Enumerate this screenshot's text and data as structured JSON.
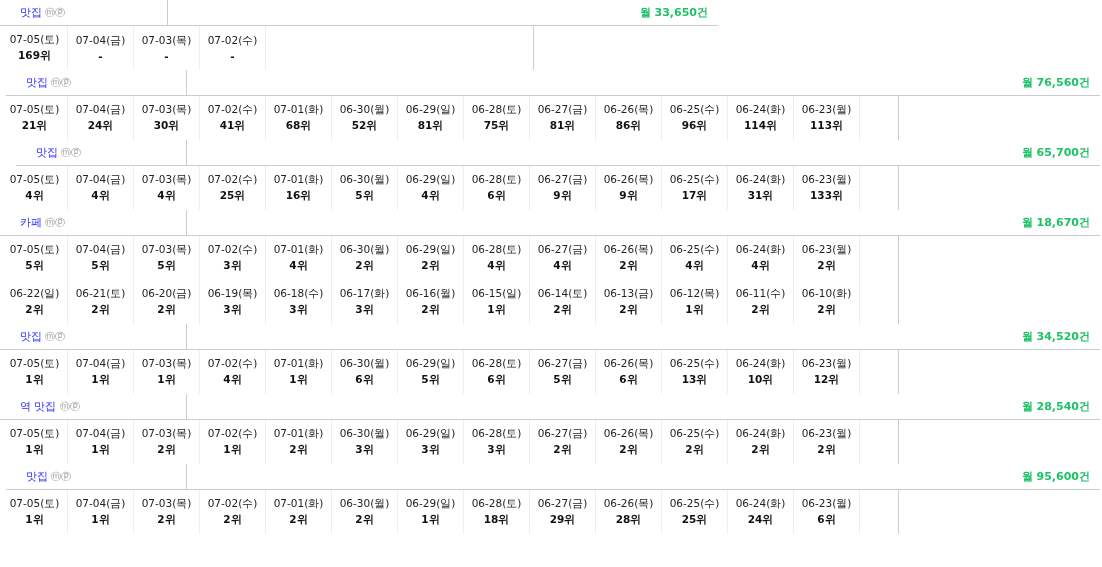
{
  "blocks": [
    {
      "label": "맛집",
      "badges": "ⓜⓟ",
      "count": "월 33,650건",
      "rows": [
        [
          {
            "date": "07-05(토)",
            "rank": "169위"
          },
          {
            "date": "07-04(금)",
            "rank": "-"
          },
          {
            "date": "07-03(목)",
            "rank": "-"
          },
          {
            "date": "07-02(수)",
            "rank": "-"
          }
        ]
      ]
    },
    {
      "label": "맛집",
      "badges": "ⓜⓟ",
      "count": "월 76,560건",
      "rows": [
        [
          {
            "date": "07-05(토)",
            "rank": "21위"
          },
          {
            "date": "07-04(금)",
            "rank": "24위"
          },
          {
            "date": "07-03(목)",
            "rank": "30위"
          },
          {
            "date": "07-02(수)",
            "rank": "41위"
          },
          {
            "date": "07-01(화)",
            "rank": "68위"
          },
          {
            "date": "06-30(월)",
            "rank": "52위"
          },
          {
            "date": "06-29(일)",
            "rank": "81위"
          },
          {
            "date": "06-28(토)",
            "rank": "75위"
          },
          {
            "date": "06-27(금)",
            "rank": "81위"
          },
          {
            "date": "06-26(목)",
            "rank": "86위"
          },
          {
            "date": "06-25(수)",
            "rank": "96위"
          },
          {
            "date": "06-24(화)",
            "rank": "114위"
          },
          {
            "date": "06-23(월)",
            "rank": "113위"
          }
        ]
      ]
    },
    {
      "label": "맛집",
      "badges": "ⓜⓟ",
      "count": "월 65,700건",
      "rows": [
        [
          {
            "date": "07-05(토)",
            "rank": "4위"
          },
          {
            "date": "07-04(금)",
            "rank": "4위"
          },
          {
            "date": "07-03(목)",
            "rank": "4위"
          },
          {
            "date": "07-02(수)",
            "rank": "25위"
          },
          {
            "date": "07-01(화)",
            "rank": "16위"
          },
          {
            "date": "06-30(월)",
            "rank": "5위"
          },
          {
            "date": "06-29(일)",
            "rank": "4위"
          },
          {
            "date": "06-28(토)",
            "rank": "6위"
          },
          {
            "date": "06-27(금)",
            "rank": "9위"
          },
          {
            "date": "06-26(목)",
            "rank": "9위"
          },
          {
            "date": "06-25(수)",
            "rank": "17위"
          },
          {
            "date": "06-24(화)",
            "rank": "31위"
          },
          {
            "date": "06-23(월)",
            "rank": "133위"
          }
        ]
      ]
    },
    {
      "label": "카페",
      "badges": "ⓜⓟ",
      "count": "월 18,670건",
      "rows": [
        [
          {
            "date": "07-05(토)",
            "rank": "5위"
          },
          {
            "date": "07-04(금)",
            "rank": "5위"
          },
          {
            "date": "07-03(목)",
            "rank": "5위"
          },
          {
            "date": "07-02(수)",
            "rank": "3위"
          },
          {
            "date": "07-01(화)",
            "rank": "4위"
          },
          {
            "date": "06-30(월)",
            "rank": "2위"
          },
          {
            "date": "06-29(일)",
            "rank": "2위"
          },
          {
            "date": "06-28(토)",
            "rank": "4위"
          },
          {
            "date": "06-27(금)",
            "rank": "4위"
          },
          {
            "date": "06-26(목)",
            "rank": "2위"
          },
          {
            "date": "06-25(수)",
            "rank": "4위"
          },
          {
            "date": "06-24(화)",
            "rank": "4위"
          },
          {
            "date": "06-23(월)",
            "rank": "2위"
          }
        ],
        [
          {
            "date": "06-22(일)",
            "rank": "2위"
          },
          {
            "date": "06-21(토)",
            "rank": "2위"
          },
          {
            "date": "06-20(금)",
            "rank": "2위"
          },
          {
            "date": "06-19(목)",
            "rank": "3위"
          },
          {
            "date": "06-18(수)",
            "rank": "3위"
          },
          {
            "date": "06-17(화)",
            "rank": "3위"
          },
          {
            "date": "06-16(월)",
            "rank": "2위"
          },
          {
            "date": "06-15(일)",
            "rank": "1위"
          },
          {
            "date": "06-14(토)",
            "rank": "2위"
          },
          {
            "date": "06-13(금)",
            "rank": "2위"
          },
          {
            "date": "06-12(목)",
            "rank": "1위"
          },
          {
            "date": "06-11(수)",
            "rank": "2위"
          },
          {
            "date": "06-10(화)",
            "rank": "2위"
          }
        ]
      ]
    },
    {
      "label": "맛집",
      "badges": "ⓜⓟ",
      "count": "월 34,520건",
      "rows": [
        [
          {
            "date": "07-05(토)",
            "rank": "1위"
          },
          {
            "date": "07-04(금)",
            "rank": "1위"
          },
          {
            "date": "07-03(목)",
            "rank": "1위"
          },
          {
            "date": "07-02(수)",
            "rank": "4위"
          },
          {
            "date": "07-01(화)",
            "rank": "1위"
          },
          {
            "date": "06-30(월)",
            "rank": "6위"
          },
          {
            "date": "06-29(일)",
            "rank": "5위"
          },
          {
            "date": "06-28(토)",
            "rank": "6위"
          },
          {
            "date": "06-27(금)",
            "rank": "5위"
          },
          {
            "date": "06-26(목)",
            "rank": "6위"
          },
          {
            "date": "06-25(수)",
            "rank": "13위"
          },
          {
            "date": "06-24(화)",
            "rank": "10위"
          },
          {
            "date": "06-23(월)",
            "rank": "12위"
          }
        ]
      ]
    },
    {
      "label": "역 맛집",
      "badges": "ⓜⓟ",
      "count": "월 28,540건",
      "rows": [
        [
          {
            "date": "07-05(토)",
            "rank": "1위"
          },
          {
            "date": "07-04(금)",
            "rank": "1위"
          },
          {
            "date": "07-03(목)",
            "rank": "2위"
          },
          {
            "date": "07-02(수)",
            "rank": "1위"
          },
          {
            "date": "07-01(화)",
            "rank": "2위"
          },
          {
            "date": "06-30(월)",
            "rank": "3위"
          },
          {
            "date": "06-29(일)",
            "rank": "3위"
          },
          {
            "date": "06-28(토)",
            "rank": "3위"
          },
          {
            "date": "06-27(금)",
            "rank": "2위"
          },
          {
            "date": "06-26(목)",
            "rank": "2위"
          },
          {
            "date": "06-25(수)",
            "rank": "2위"
          },
          {
            "date": "06-24(화)",
            "rank": "2위"
          },
          {
            "date": "06-23(월)",
            "rank": "2위"
          }
        ]
      ]
    },
    {
      "label": "맛집",
      "badges": "ⓜⓟ",
      "count": "월 95,600건",
      "rows": [
        [
          {
            "date": "07-05(토)",
            "rank": "1위"
          },
          {
            "date": "07-04(금)",
            "rank": "1위"
          },
          {
            "date": "07-03(목)",
            "rank": "2위"
          },
          {
            "date": "07-02(수)",
            "rank": "2위"
          },
          {
            "date": "07-01(화)",
            "rank": "2위"
          },
          {
            "date": "06-30(월)",
            "rank": "2위"
          },
          {
            "date": "06-29(일)",
            "rank": "1위"
          },
          {
            "date": "06-28(토)",
            "rank": "18위"
          },
          {
            "date": "06-27(금)",
            "rank": "29위"
          },
          {
            "date": "06-26(목)",
            "rank": "28위"
          },
          {
            "date": "06-25(수)",
            "rank": "25위"
          },
          {
            "date": "06-24(화)",
            "rank": "24위"
          },
          {
            "date": "06-23(월)",
            "rank": "6위"
          }
        ]
      ]
    }
  ]
}
